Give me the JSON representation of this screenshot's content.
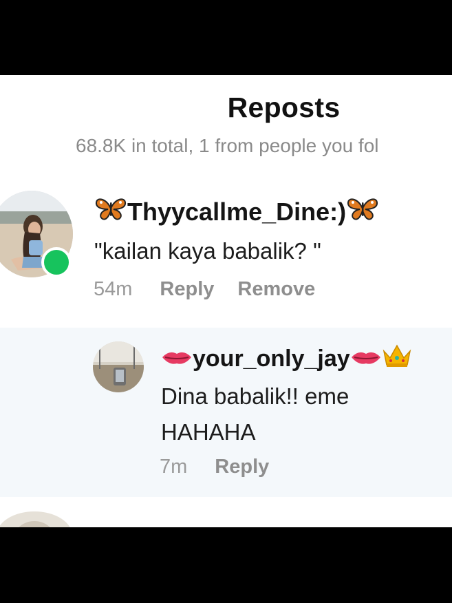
{
  "header": {
    "title": "Reposts",
    "subtitle": "68.8K in total, 1 from people you fol"
  },
  "comments": [
    {
      "username": "Thyycallme_Dine:)",
      "text": "\"kailan kaya babalik? \"",
      "time": "54m",
      "reply_label": "Reply",
      "remove_label": "Remove",
      "online": true
    }
  ],
  "replies": [
    {
      "username": "your_only_jay",
      "text": "Dina babalik!! eme HAHAHA",
      "time": "7m",
      "reply_label": "Reply"
    }
  ],
  "icons": {
    "butterfly": "butterfly-icon",
    "lips": "lips-icon",
    "crown": "crown-icon"
  },
  "colors": {
    "online": "#17c35d",
    "reply_bg": "#f4f8fb"
  }
}
